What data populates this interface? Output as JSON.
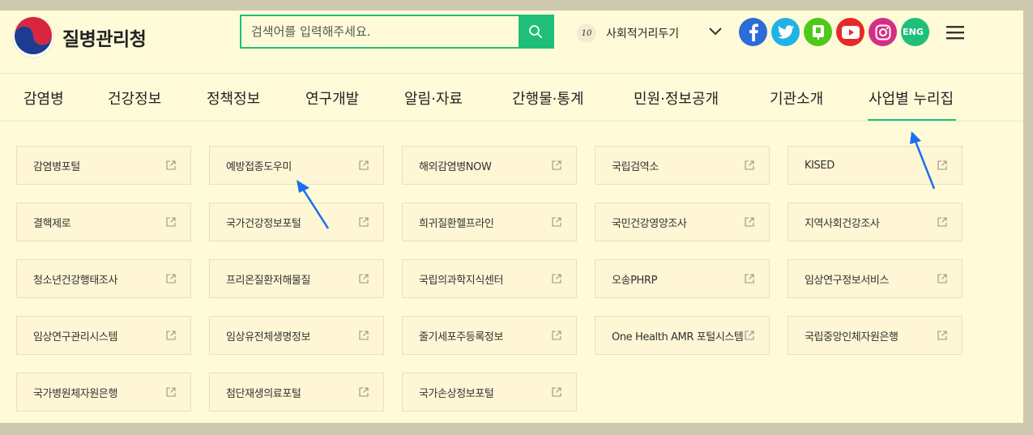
{
  "header": {
    "logo_text": "질병관리청",
    "search": {
      "placeholder": "검색어를 입력해주세요.",
      "value": ""
    },
    "distance": {
      "level": "10",
      "label": "사회적거리두기"
    },
    "sns": [
      {
        "name": "facebook-icon",
        "color": "#2d6cd8"
      },
      {
        "name": "twitter-icon",
        "color": "#21b2e6"
      },
      {
        "name": "kakaostory-icon",
        "color": "#4fc81a"
      },
      {
        "name": "youtube-icon",
        "color": "#e52b27"
      },
      {
        "name": "instagram-icon",
        "color": "#d42f86"
      },
      {
        "name": "eng-link",
        "color": "#1fbf7a",
        "label": "ENG"
      }
    ]
  },
  "gnb": {
    "items": [
      {
        "label": "감염병"
      },
      {
        "label": "건강정보"
      },
      {
        "label": "정책정보"
      },
      {
        "label": "연구개발"
      },
      {
        "label": "알림·자료"
      },
      {
        "label": "간행물·통계"
      },
      {
        "label": "민원·정보공개"
      },
      {
        "label": "기관소개"
      },
      {
        "label": "사업별 누리집"
      }
    ],
    "active_index": 8
  },
  "sites": [
    "감염병포털",
    "예방접종도우미",
    "해외감염병NOW",
    "국립검역소",
    "KISED",
    "결핵제로",
    "국가건강정보포털",
    "희귀질환헬프라인",
    "국민건강영양조사",
    "지역사회건강조사",
    "청소년건강행태조사",
    "프리온질환저해물질",
    "국립의과학지식센터",
    "오송PHRP",
    "임상연구정보서비스",
    "임상연구관리시스템",
    "임상유전체생명정보",
    "줄기세포주등록정보",
    "One Health AMR 포털시스템",
    "국립중앙인체자원은행",
    "국가병원체자원은행",
    "첨단재생의료포털",
    "국가손상정보포털"
  ],
  "colors": {
    "accent": "#1fbf7a",
    "arrow": "#1a6ff0"
  }
}
